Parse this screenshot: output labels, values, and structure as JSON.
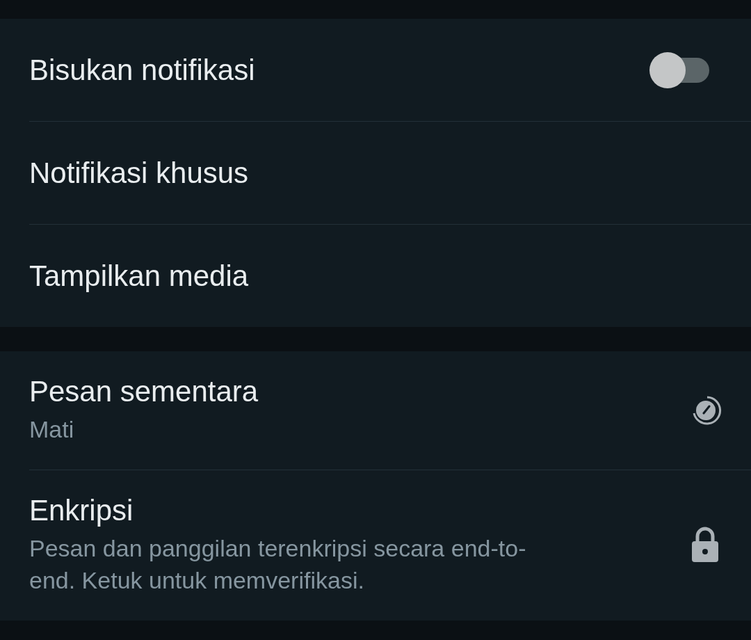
{
  "sections": [
    {
      "rows": [
        {
          "kind": "toggle",
          "title": "Bisukan notifikasi",
          "on": false
        },
        {
          "kind": "plain",
          "title": "Notifikasi khusus"
        },
        {
          "kind": "plain",
          "title": "Tampilkan media"
        }
      ]
    },
    {
      "rows": [
        {
          "kind": "timer",
          "title": "Pesan sementara",
          "subtitle": "Mati"
        },
        {
          "kind": "lock",
          "title": "Enkripsi",
          "subtitle": "Pesan dan panggilan terenkripsi secara end-to-end. Ketuk untuk memverifikasi."
        }
      ]
    }
  ]
}
